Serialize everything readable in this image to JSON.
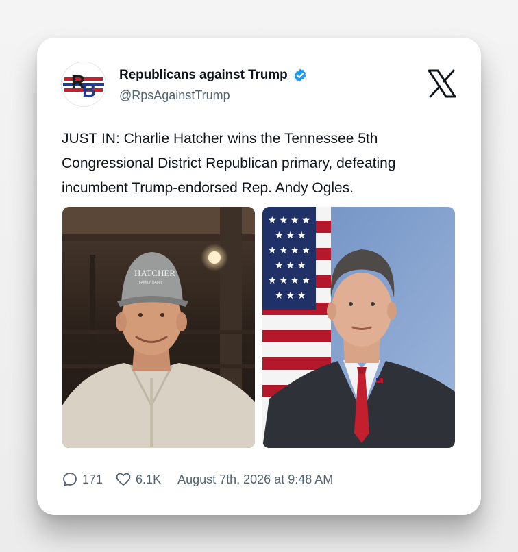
{
  "account": {
    "name": "Republicans against Trump",
    "handle": "@RpsAgainstTrump",
    "avatar_letters": "RB",
    "verified": true
  },
  "platform_icon": "x-logo-icon",
  "tweet": {
    "text": "JUST IN: Charlie Hatcher wins the Tennessee 5th Congressional District Republican primary, defeating incumbent Trump-endorsed Rep. Andy Ogles."
  },
  "photos": [
    {
      "name": "hatcher-photo",
      "cap_text": "HATCHER",
      "cap_subtext": "FAMILY DAIRY"
    },
    {
      "name": "ogles-photo"
    }
  ],
  "footer": {
    "reply_count": "171",
    "like_count": "6.1K",
    "timestamp": "August 7th, 2026 at 9:48 AM"
  },
  "colors": {
    "verified_blue": "#1d9bf0",
    "text_primary": "#0f1419",
    "text_secondary": "#536471"
  }
}
